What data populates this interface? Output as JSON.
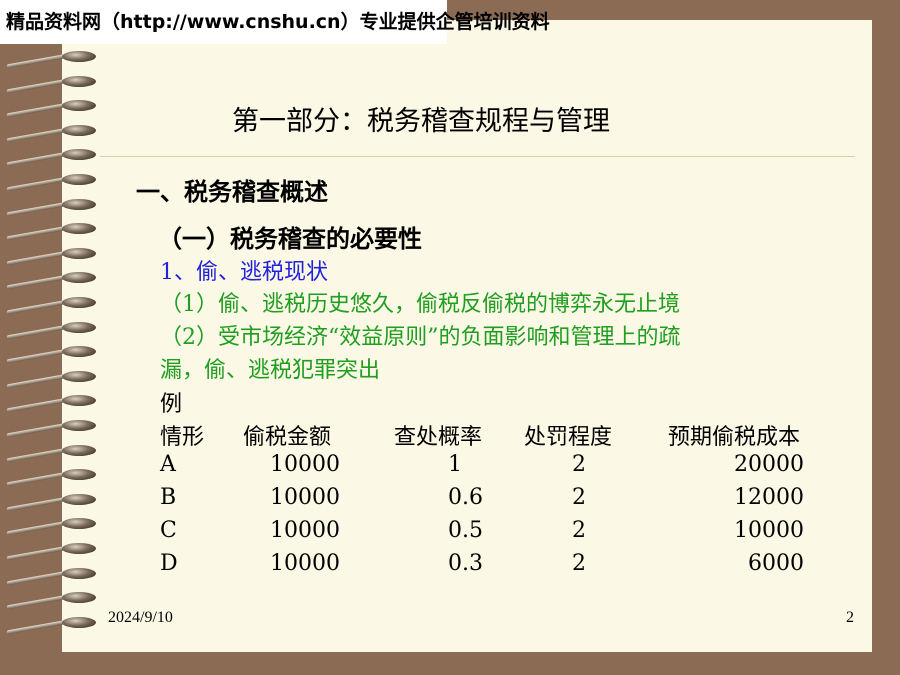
{
  "watermark": "精品资料网（http://www.cnshu.cn）专业提供企管培训资料",
  "title": "第一部分：税务稽查规程与管理",
  "section_heading": "一、税务稽查概述",
  "subsection_heading": "（一）税务稽查的必要性",
  "point_heading": "1、偷、逃税现状",
  "points": [
    "（1）偷、逃税历史悠久，偷税反偷税的博弈永无止境",
    "（2）受市场经济“效益原则”的负面影响和管理上的疏",
    "漏，偷、逃税犯罪突出"
  ],
  "example_label": "例",
  "table": {
    "headers": [
      "情形",
      "偷税金额",
      "查处概率",
      "处罚程度",
      "预期偷税成本"
    ],
    "rows": [
      [
        "A",
        "10000",
        "1",
        "2",
        "20000"
      ],
      [
        "B",
        "10000",
        "0.6",
        "2",
        "12000"
      ],
      [
        "C",
        "10000",
        "0.5",
        "2",
        "10000"
      ],
      [
        "D",
        "10000",
        "0.3",
        "2",
        "6000"
      ]
    ]
  },
  "footer": {
    "date": "2024/9/10",
    "page": "2"
  },
  "colors": {
    "frame": "#8c6b55",
    "slide": "#fbf8e6",
    "blue_text": "#2222dd",
    "green_text": "#1f9e1f"
  }
}
